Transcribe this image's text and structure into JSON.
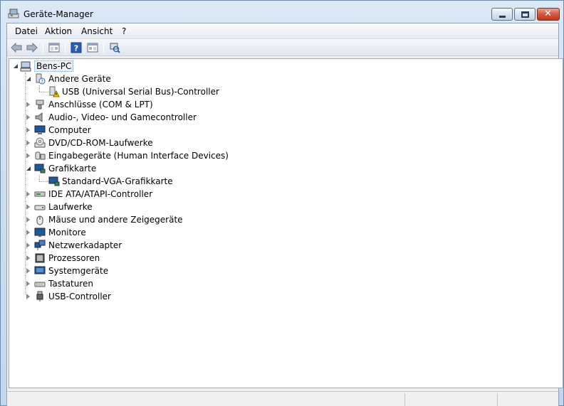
{
  "window": {
    "title": "Geräte-Manager",
    "close_glyph": "✕"
  },
  "menu": [
    "Datei",
    "Aktion",
    "Ansicht",
    "?"
  ],
  "toolbar": {
    "icons": [
      "back-icon",
      "forward-icon",
      "properties-view-icon",
      "help-icon",
      "action-view-icon",
      "scan-hardware-icon"
    ]
  },
  "tree": {
    "root": "Bens-PC",
    "nodes": [
      {
        "label": "Andere Geräte",
        "state": "expanded",
        "icon": "unknown-device-icon",
        "children": [
          {
            "label": "USB (Universal Serial Bus)-Controller",
            "icon": "warning-device-icon"
          }
        ]
      },
      {
        "label": "Anschlüsse (COM & LPT)",
        "state": "collapsed",
        "icon": "port-icon"
      },
      {
        "label": "Audio-, Video- und Gamecontroller",
        "state": "collapsed",
        "icon": "speaker-icon"
      },
      {
        "label": "Computer",
        "state": "collapsed",
        "icon": "computer-icon"
      },
      {
        "label": "DVD/CD-ROM-Laufwerke",
        "state": "collapsed",
        "icon": "dvd-drive-icon"
      },
      {
        "label": "Eingabegeräte (Human Interface Devices)",
        "state": "collapsed",
        "icon": "hid-icon"
      },
      {
        "label": "Grafikkarte",
        "state": "expanded",
        "icon": "display-adapter-icon",
        "children": [
          {
            "label": "Standard-VGA-Grafikkarte",
            "icon": "display-adapter-icon"
          }
        ]
      },
      {
        "label": "IDE ATA/ATAPI-Controller",
        "state": "collapsed",
        "icon": "ide-controller-icon"
      },
      {
        "label": "Laufwerke",
        "state": "collapsed",
        "icon": "disk-drive-icon"
      },
      {
        "label": "Mäuse und andere Zeigegeräte",
        "state": "collapsed",
        "icon": "mouse-icon"
      },
      {
        "label": "Monitore",
        "state": "collapsed",
        "icon": "monitor-icon"
      },
      {
        "label": "Netzwerkadapter",
        "state": "collapsed",
        "icon": "network-adapter-icon"
      },
      {
        "label": "Prozessoren",
        "state": "collapsed",
        "icon": "processor-icon"
      },
      {
        "label": "Systemgeräte",
        "state": "collapsed",
        "icon": "system-devices-icon"
      },
      {
        "label": "Tastaturen",
        "state": "collapsed",
        "icon": "keyboard-icon"
      },
      {
        "label": "USB-Controller",
        "state": "collapsed",
        "icon": "usb-icon"
      }
    ]
  },
  "colors": {
    "accent": "#1c5a9c",
    "warning": "#f2c400"
  }
}
